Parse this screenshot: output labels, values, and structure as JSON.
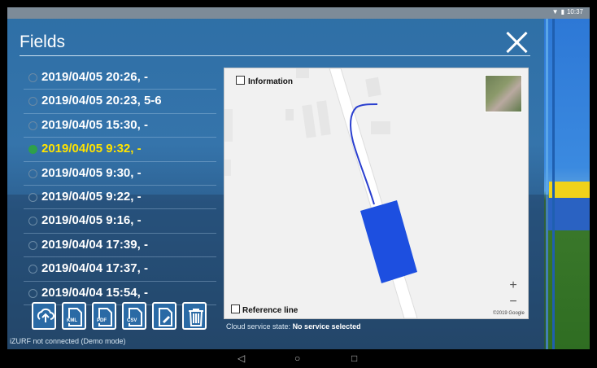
{
  "status_bar": {
    "time": "10:37",
    "icons": [
      "wifi-icon",
      "battery-icon"
    ]
  },
  "header": {
    "title": "Fields"
  },
  "fields": [
    {
      "label": "2019/04/05 20:26, -",
      "selected": false
    },
    {
      "label": "2019/04/05 20:23, 5-6",
      "selected": false
    },
    {
      "label": "2019/04/05 15:30, -",
      "selected": false
    },
    {
      "label": "2019/04/05 9:32, -",
      "selected": true
    },
    {
      "label": "2019/04/05 9:30, -",
      "selected": false
    },
    {
      "label": "2019/04/05 9:22, -",
      "selected": false
    },
    {
      "label": "2019/04/05 9:16, -",
      "selected": false
    },
    {
      "label": "2019/04/04 17:39, -",
      "selected": false
    },
    {
      "label": "2019/04/04 17:37, -",
      "selected": false
    },
    {
      "label": "2019/04/04 15:54, -",
      "selected": false
    }
  ],
  "toolbar": {
    "buttons": [
      {
        "name": "cloud-upload-button",
        "icon": "cloud-upload-icon",
        "tag": ""
      },
      {
        "name": "export-kml-button",
        "icon": "kml-export-icon",
        "tag": "KML"
      },
      {
        "name": "export-pdf-button",
        "icon": "pdf-export-icon",
        "tag": "PDF"
      },
      {
        "name": "export-csv-button",
        "icon": "csv-export-icon",
        "tag": "CSV"
      },
      {
        "name": "edit-field-button",
        "icon": "edit-icon",
        "tag": ""
      },
      {
        "name": "delete-field-button",
        "icon": "trash-icon",
        "tag": ""
      }
    ]
  },
  "footer": {
    "connection": "iZURF not connected (Demo mode)"
  },
  "map": {
    "information_label": "Information",
    "reference_line_label": "Reference line",
    "zoom_in": "+",
    "zoom_out": "−",
    "copyright": "©2019 Google",
    "google_logo": "Google"
  },
  "cloud_service": {
    "label": "Cloud service state:",
    "value": "No service selected"
  },
  "nav": {
    "back": "◁",
    "home": "○",
    "recents": "□"
  },
  "colors": {
    "selected": "#ffe400",
    "track": "#2a3fcf",
    "field_fill": "#1d4fe0"
  }
}
